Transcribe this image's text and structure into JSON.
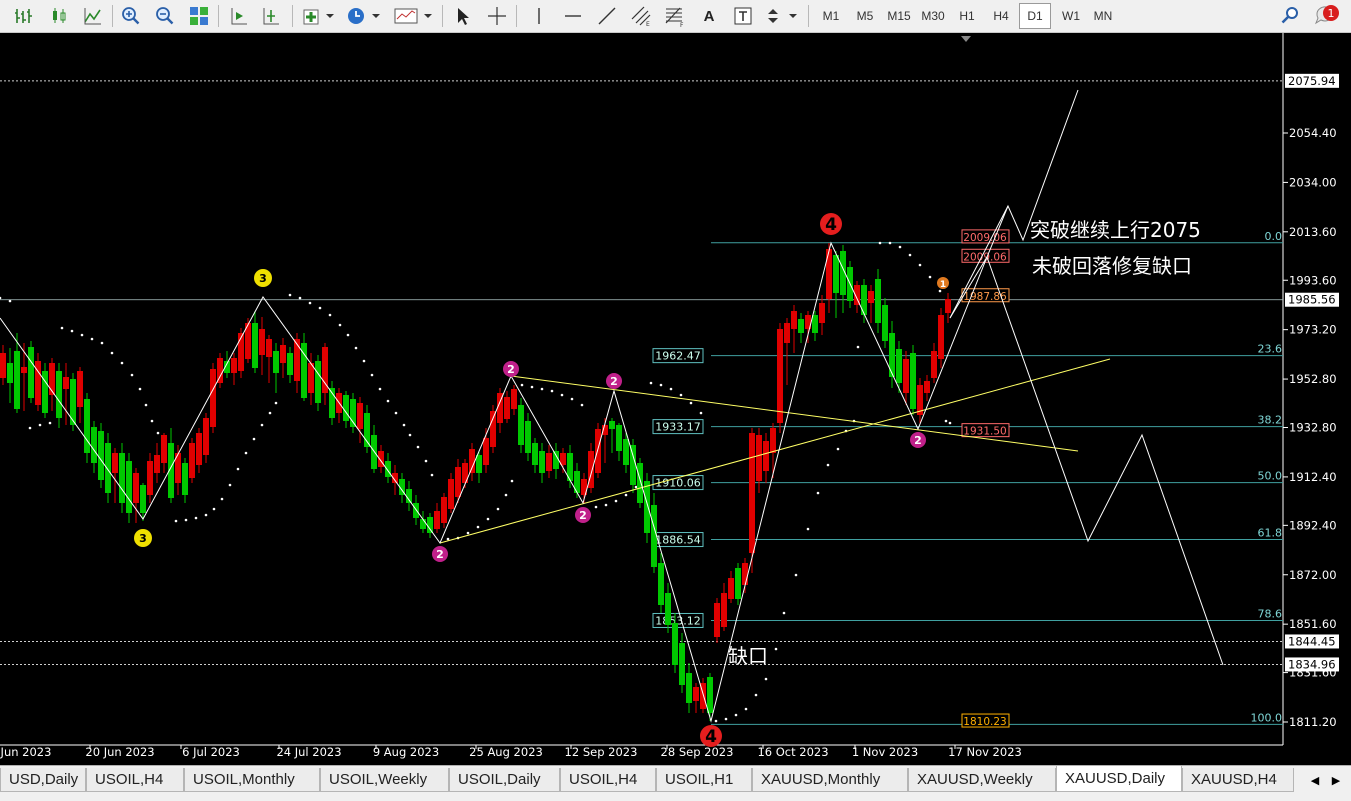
{
  "toolbar": {
    "tools": [
      {
        "icon": "bar-chart-icon"
      },
      {
        "icon": "candlestick-icon"
      },
      {
        "icon": "line-chart-icon"
      },
      {
        "icon": "zoom-in-icon"
      },
      {
        "icon": "zoom-out-icon"
      },
      {
        "icon": "tile-windows-icon"
      },
      {
        "icon": "auto-scroll-icon"
      },
      {
        "icon": "chart-shift-icon"
      },
      {
        "icon": "indicators-icon"
      },
      {
        "icon": "periods-icon"
      },
      {
        "icon": "templates-icon"
      },
      {
        "icon": "cursor-icon"
      },
      {
        "icon": "crosshair-icon"
      },
      {
        "icon": "vertical-line-icon"
      },
      {
        "icon": "horizontal-line-icon"
      },
      {
        "icon": "trendline-icon"
      },
      {
        "icon": "equidistant-channel-icon"
      },
      {
        "icon": "fibonacci-icon"
      },
      {
        "icon": "text-icon"
      },
      {
        "icon": "text-label-icon"
      },
      {
        "icon": "arrows-icon"
      }
    ],
    "text_tool": "A",
    "timeframes": [
      "M1",
      "M5",
      "M15",
      "M30",
      "H1",
      "H4",
      "D1",
      "W1",
      "MN"
    ],
    "active_timeframe": "D1",
    "notification_count": "1"
  },
  "chart": {
    "symbol": "XAUUSD",
    "period": "Daily",
    "colors": {
      "background": "#000000",
      "bull": "#00c800",
      "bear": "#e00000",
      "grid": "#ffffff",
      "fib": "#40a0a0",
      "zigzag": "#ffffff",
      "trend": "#ffff66"
    },
    "price_axis": [
      "2054.40",
      "2034.00",
      "2013.60",
      "1993.60",
      "1973.20",
      "1952.80",
      "1932.80",
      "1912.40",
      "1892.40",
      "1872.00",
      "1851.60",
      "1831.60",
      "1811.20"
    ],
    "price_tags": {
      "top_line": "2075.94",
      "current": "1985.56",
      "line_1844": "1844.45",
      "line_1834": "1834.96"
    },
    "date_axis": [
      "Jun 2023",
      "20 Jun 2023",
      "6 Jul 2023",
      "24 Jul 2023",
      "9 Aug 2023",
      "25 Aug 2023",
      "12 Sep 2023",
      "28 Sep 2023",
      "16 Oct 2023",
      "1 Nov 2023",
      "17 Nov 2023"
    ],
    "fib_levels": [
      {
        "ratio": "0.0",
        "price": "2009.06"
      },
      {
        "ratio": "23.6",
        "price": "1962.47"
      },
      {
        "ratio": "38.2",
        "price": "1933.17"
      },
      {
        "ratio": "50.0",
        "price": "1910.06"
      },
      {
        "ratio": "61.8",
        "price": "1886.54"
      },
      {
        "ratio": "78.6",
        "price": "1853.12"
      },
      {
        "ratio": "100.0",
        "price": "1810.23"
      }
    ],
    "right_labels": {
      "high_a": "2009.06",
      "high_b": "2009.06",
      "mid": "1987.86",
      "low": "1931.50",
      "bottom": "1810.23"
    },
    "wave_labels": [
      "3",
      "3",
      "2",
      "2",
      "2",
      "2",
      "4",
      "4",
      "2",
      "1"
    ],
    "annotations": {
      "bullish": "突破继续上行2075",
      "bearish": "未破回落修复缺口",
      "gap": "缺口"
    }
  },
  "tabs": [
    "USD,Daily",
    "USOIL,H4",
    "USOIL,Monthly",
    "USOIL,Weekly",
    "USOIL,Daily",
    "USOIL,H4",
    "USOIL,H1",
    "XAUUSD,Monthly",
    "XAUUSD,Weekly",
    "XAUUSD,Daily",
    "XAUUSD,H4"
  ],
  "active_tab": "XAUUSD,Daily"
}
